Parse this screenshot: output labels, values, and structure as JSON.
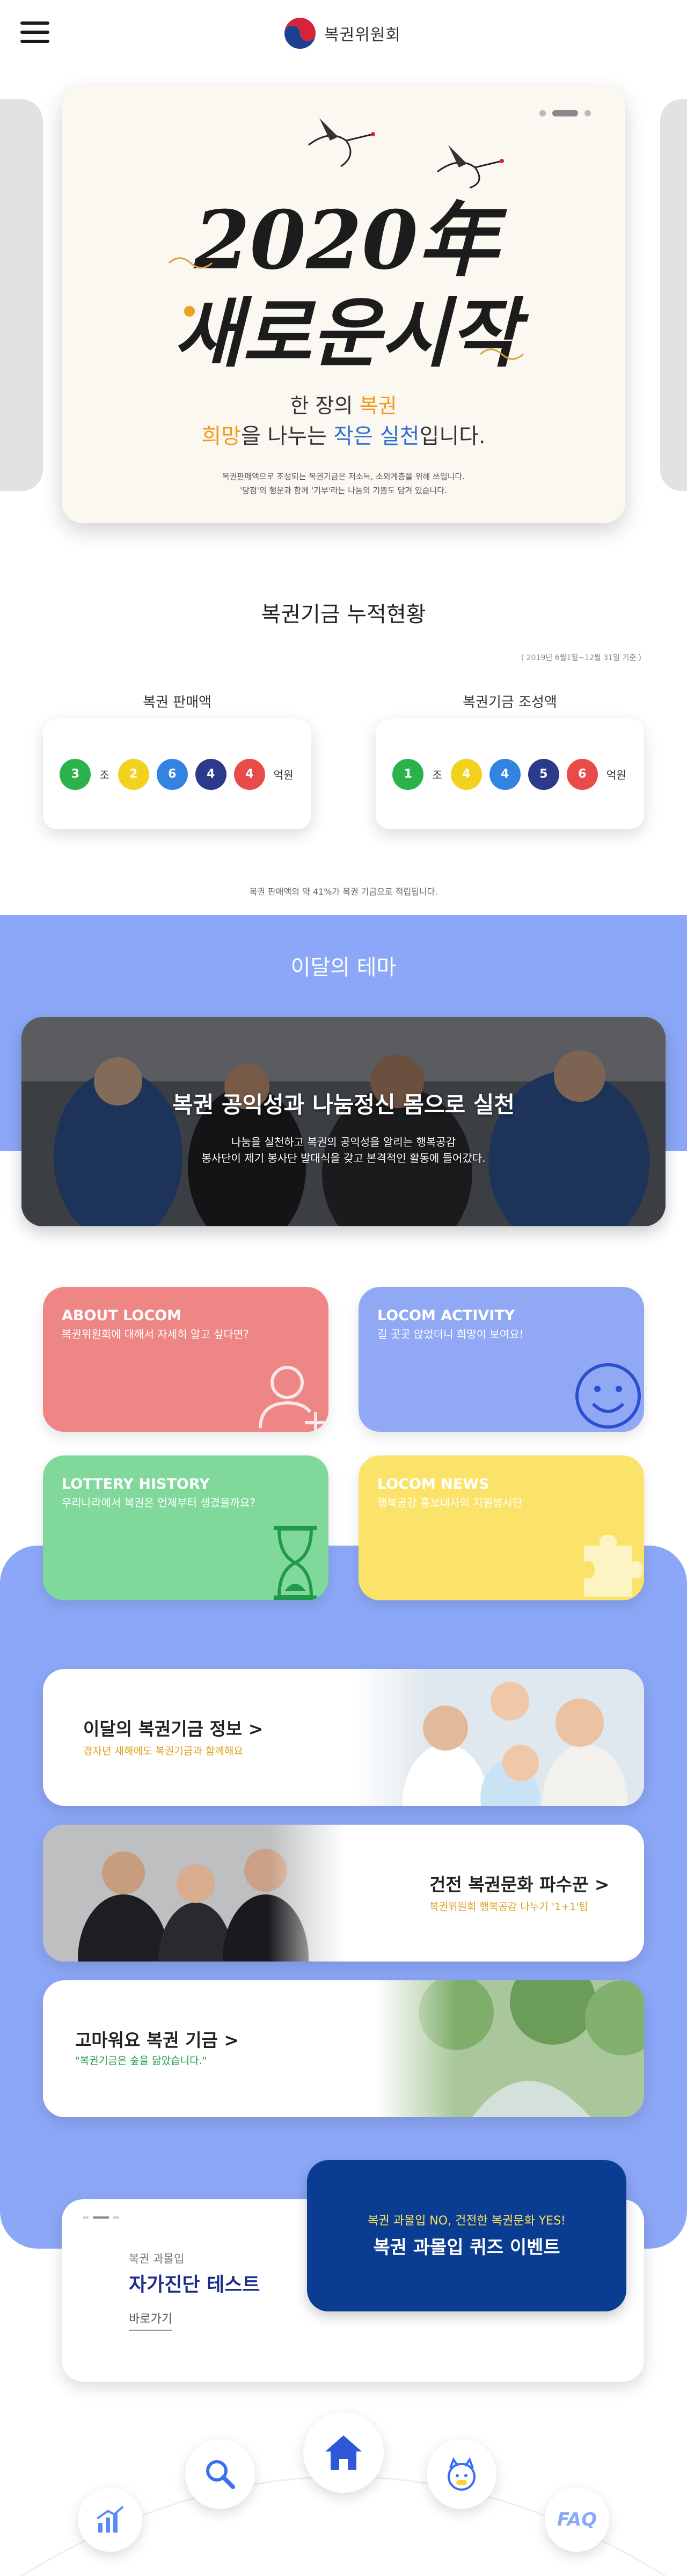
{
  "header": {
    "menu_icon": "hamburger-menu-icon",
    "logo_text": "복권위원회"
  },
  "hero": {
    "calligraphy_text": "2020年 새로운시작",
    "line1_prefix": "한 장의 ",
    "line1_highlight": "복권",
    "line2_part1": "희망",
    "line2_part2": "을 나누는 ",
    "line2_part3": "작은 실천",
    "line2_part4": "입니다.",
    "small_line1": "복권판매액으로 조성되는 복권기금은 저소득, 소외계층을 위해 쓰입니다.",
    "small_line2": "'당첨'의 행운과 함께 '기부'라는 나눔의 기쁨도 담겨 있습니다.",
    "colors": {
      "orange": "#f39a1e",
      "blue": "#2c6fd1",
      "green": "#2aa84a"
    }
  },
  "fund": {
    "title": "복권기금 누적현황",
    "period": "( 2019년 6월1일~12월 31일 기준 )",
    "sales_label": "복권 판매액",
    "fund_label": "복권기금 조성액",
    "sales_digits": [
      "3",
      "2",
      "6",
      "4",
      "4"
    ],
    "fund_digits": [
      "1",
      "4",
      "4",
      "5",
      "6"
    ],
    "unit_jo": "조",
    "unit_eok": "억원",
    "note": "복권 판매액의 약 41%가 복권 기금으로 적립됩니다.",
    "digit_colors": [
      "#2bb24c",
      "#f2d21e",
      "#3384e0",
      "#2d3a8c",
      "#e94b4b"
    ]
  },
  "theme": {
    "title": "이달의 테마",
    "headline": "복권 공익성과 나눔정신 몸으로 실천",
    "sub1": "나눔을 실천하고 복권의 공익성을 알리는 행복공감",
    "sub2": "봉사단이 제기 봉사단 발대식을 갖고 본격적인 활동에 들어갔다."
  },
  "tiles": [
    {
      "title": "ABOUT LOCOM",
      "sub": "복권위원회에 대해서 자세히 알고 싶다면?",
      "color": "#ee8686",
      "icon": "add-user-icon"
    },
    {
      "title": "LOCOM ACTIVITY",
      "sub": "길 곳곳 앉었더니 희망이 보여요!",
      "color": "#91a9f4",
      "icon": "smile-icon"
    },
    {
      "title": "LOTTERY HISTORY",
      "sub": "우리나라에서 복권은 언제부터 생겼을까요?",
      "color": "#80d89b",
      "icon": "hourglass-icon"
    },
    {
      "title": "LOCOM NEWS",
      "sub": "행복공감 홍보대사의 지원봉사단",
      "color": "#fbe36a",
      "icon": "puzzle-icon"
    }
  ],
  "info_cards": [
    {
      "title": "이달의 복권기금 정보 >",
      "sub": "경자년 새해에도 복권기금과 함께해요"
    },
    {
      "title": "건전 복권문화 파수꾼 >",
      "sub": "복권위원회 행복공감 나누기 '1+1'팀"
    },
    {
      "title": "고마워요 복권 기금 >",
      "sub": "\"복권기금은 숲을 닮았습니다.\""
    }
  ],
  "selftest": {
    "pre": "복권 과몰입",
    "title": "자가진단 테스트",
    "link": "바로가기"
  },
  "quiz": {
    "line1": "복권 과몰입 NO, 건전한 복권문화 YES!",
    "line2": "복권 과몰입 퀴즈 이벤트"
  },
  "dock": {
    "home_icon": "home-icon",
    "search_icon": "search-icon",
    "mascot_icon": "mascot-icon",
    "stats_icon": "stats-icon",
    "faq_label": "FAQ"
  }
}
